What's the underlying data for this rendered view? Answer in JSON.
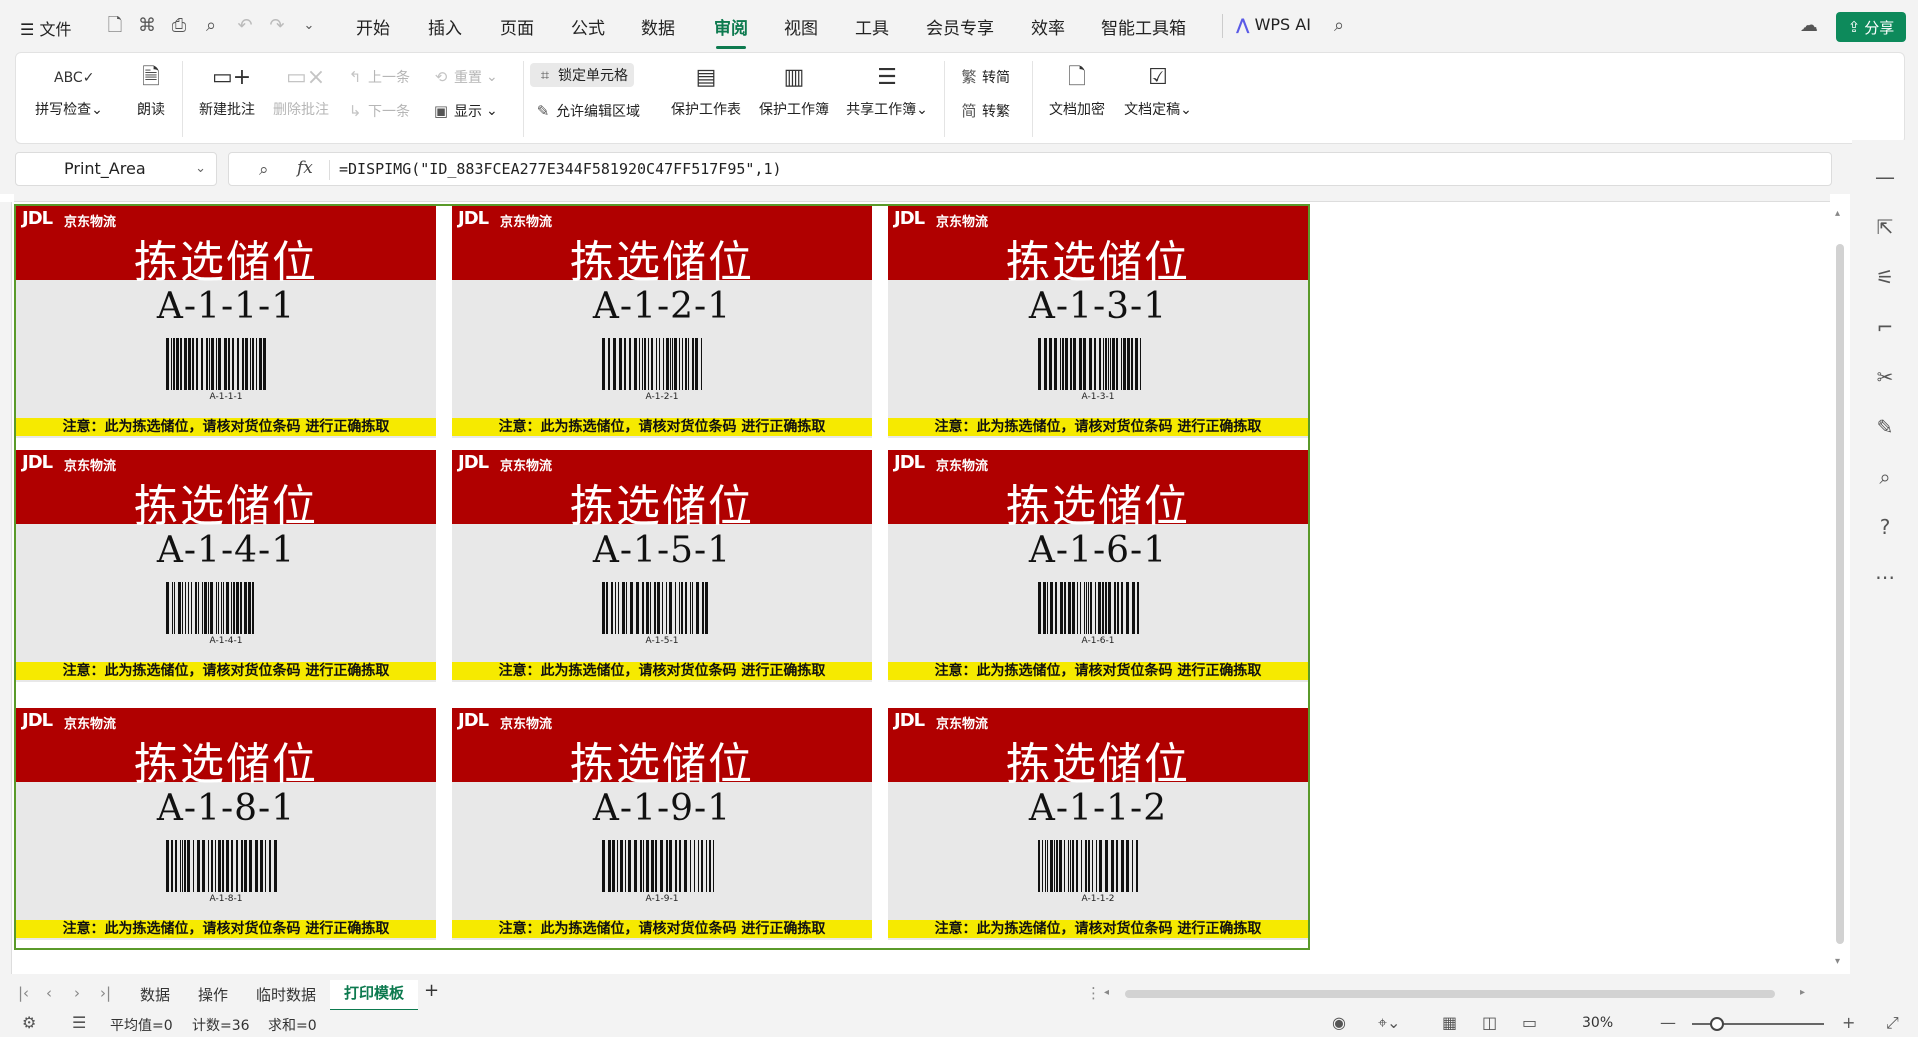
{
  "menubar": {
    "menu_label": "文件",
    "tabs": [
      "开始",
      "插入",
      "页面",
      "公式",
      "数据",
      "审阅",
      "视图",
      "工具",
      "会员专享",
      "效率",
      "智能工具箱"
    ],
    "active_tab": "审阅",
    "wps_ai": "WPS AI",
    "share": "分享"
  },
  "ribbon": {
    "spellcheck": "拼写检查",
    "read_aloud": "朗读",
    "new_comment": "新建批注",
    "delete_comment": "删除批注",
    "prev": "上一条",
    "next": "下一条",
    "reset": "重置",
    "show": "显示",
    "lock_cell": "锁定单元格",
    "allow_edit": "允许编辑区域",
    "protect_sheet": "保护工作表",
    "protect_book": "保护工作簿",
    "share_book": "共享工作簿",
    "to_simplified": "转简",
    "to_traditional": "转繁",
    "doc_encrypt": "文档加密",
    "doc_finalize": "文档定稿"
  },
  "formula_bar": {
    "name_box": "Print_Area",
    "fx": "fx",
    "formula": "=DISPIMG(\"ID_883FCEA277E344F581920C47FF517F95\",1)"
  },
  "labels": {
    "logo": "JDL",
    "logo_cn": "京东物流",
    "title": "拣选储位",
    "notice": "注意：此为拣选储位，请核对货位条码 进行正确拣取",
    "codes": [
      "A-1-1-1",
      "A-1-2-1",
      "A-1-3-1",
      "A-1-4-1",
      "A-1-5-1",
      "A-1-6-1",
      "A-1-8-1",
      "A-1-9-1",
      "A-1-1-2"
    ]
  },
  "sheet_tabs": [
    "数据",
    "操作",
    "临时数据",
    "打印模板"
  ],
  "active_sheet": "打印模板",
  "status": {
    "average": "平均值=0",
    "count": "计数=36",
    "sum": "求和=0",
    "zoom": "30%"
  },
  "colors": {
    "accent": "#0d7a4f",
    "banner_red": "#b00000",
    "notice_yellow": "#f6ea00",
    "print_area_border": "#5a9a2a"
  }
}
